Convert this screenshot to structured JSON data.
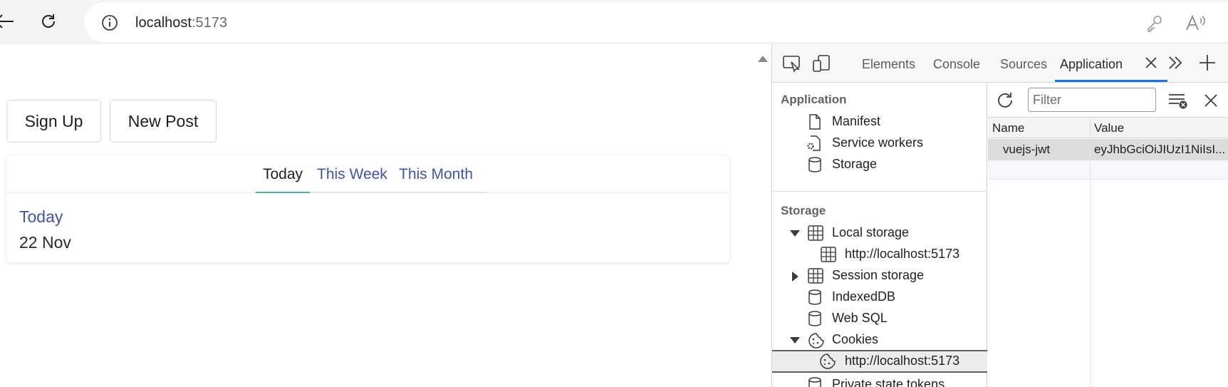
{
  "browser": {
    "address_host": "localhost",
    "address_port": ":5173",
    "icons": [
      "back-arrow-icon",
      "reload-icon",
      "info-icon",
      "key-icon",
      "read-aloud-icon"
    ]
  },
  "page": {
    "buttons": {
      "sign_up": "Sign Up",
      "new_post": "New Post"
    },
    "tabs": [
      "Today",
      "This Week",
      "This Month"
    ],
    "active_tab": "Today",
    "card_title": "Today",
    "card_date": "22 Nov",
    "colors": {
      "link": "#3f51b5",
      "active_underline": "#42b8a2"
    }
  },
  "devtools": {
    "tabs": [
      "Elements",
      "Console",
      "Sources",
      "Application"
    ],
    "active_tab": "Application",
    "sidebar": {
      "application_header": "Application",
      "application_items": [
        "Manifest",
        "Service workers",
        "Storage"
      ],
      "storage_header": "Storage",
      "storage_items": {
        "local_storage": "Local storage",
        "local_storage_origin": "http://localhost:5173",
        "session_storage": "Session storage",
        "indexeddb": "IndexedDB",
        "web_sql": "Web SQL",
        "cookies": "Cookies",
        "cookies_origin": "http://localhost:5173",
        "private_state_tokens": "Private state tokens"
      }
    },
    "filter_placeholder": "Filter",
    "table": {
      "columns": [
        "Name",
        "Value"
      ],
      "rows": [
        {
          "name": "vuejs-jwt",
          "value": "eyJhbGciOiJIUzI1NiIsI..."
        }
      ]
    },
    "colors": {
      "active_tab_line": "#1a73e8"
    }
  }
}
